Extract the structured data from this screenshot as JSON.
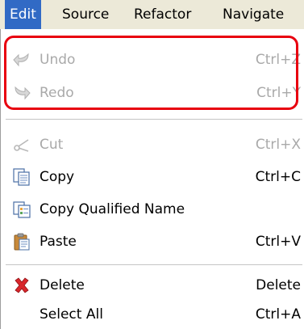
{
  "menubar": {
    "items": [
      {
        "label": "Edit",
        "active": true
      },
      {
        "label": "Source",
        "active": false
      },
      {
        "label": "Refactor",
        "active": false
      },
      {
        "label": "Navigate",
        "active": false
      }
    ]
  },
  "menu": {
    "items": [
      {
        "label": "Undo",
        "shortcut": "Ctrl+Z",
        "icon": "undo-icon",
        "enabled": false
      },
      {
        "label": "Redo",
        "shortcut": "Ctrl+Y",
        "icon": "redo-icon",
        "enabled": false
      },
      {
        "label": "Cut",
        "shortcut": "Ctrl+X",
        "icon": "scissors-icon",
        "enabled": false
      },
      {
        "label": "Copy",
        "shortcut": "Ctrl+C",
        "icon": "copy-icon",
        "enabled": true
      },
      {
        "label": "Copy Qualified Name",
        "shortcut": "",
        "icon": "copy-qualified-name-icon",
        "enabled": true
      },
      {
        "label": "Paste",
        "shortcut": "Ctrl+V",
        "icon": "clipboard-icon",
        "enabled": true
      },
      {
        "label": "Delete",
        "shortcut": "Delete",
        "icon": "delete-x-icon",
        "enabled": true
      },
      {
        "label": "Select All",
        "shortcut": "Ctrl+A",
        "icon": "",
        "enabled": true
      }
    ]
  },
  "colors": {
    "menubar_active_bg": "#316ac5",
    "highlight_box": "#e8000f",
    "disabled_text": "#a9a9a9",
    "delete_icon": "#d9262b"
  }
}
